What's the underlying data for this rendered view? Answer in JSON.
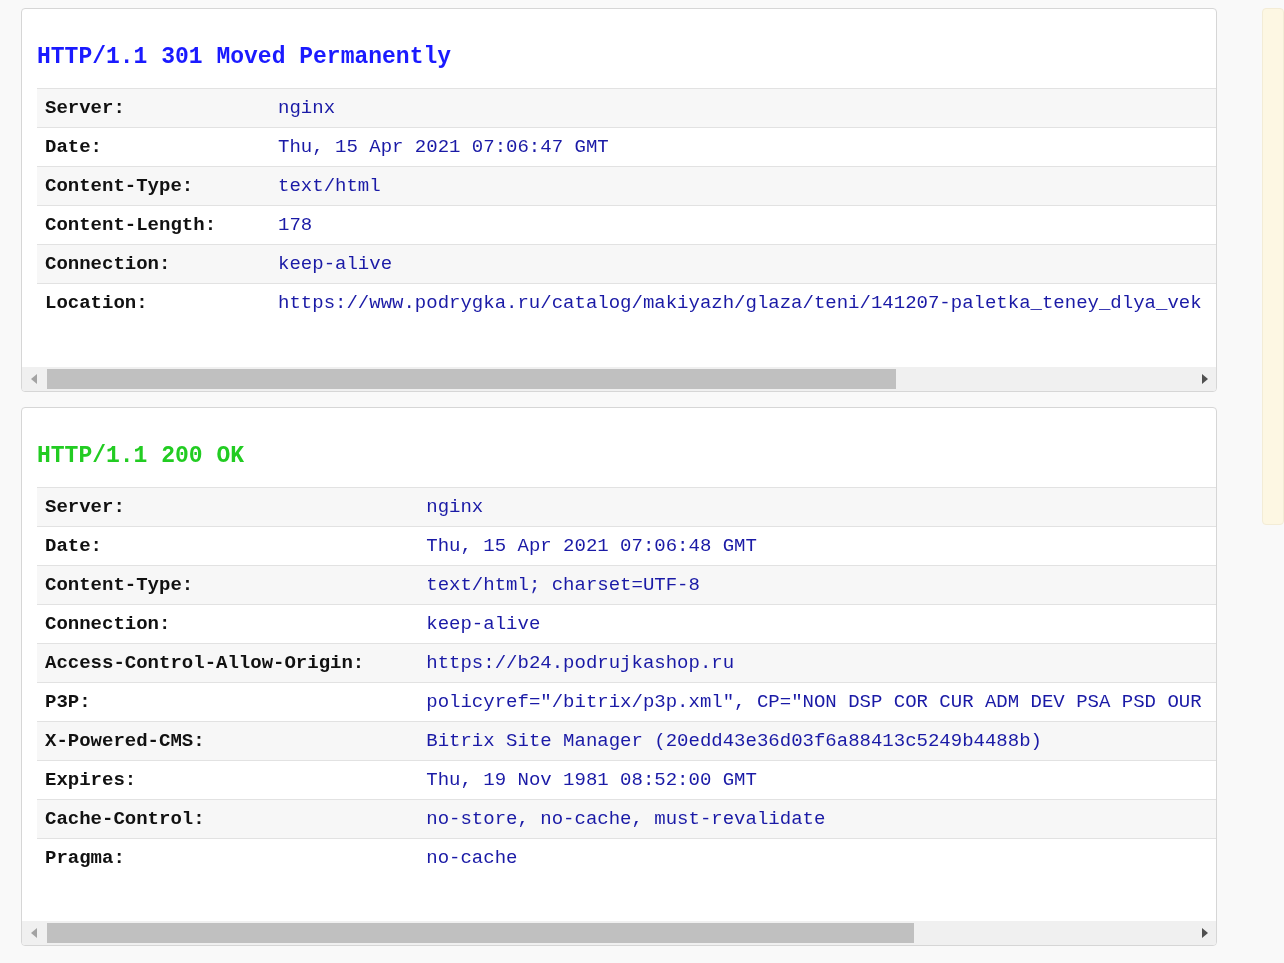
{
  "responses": [
    {
      "status_line": "HTTP/1.1 301 Moved Permanently",
      "color": "#1a1aff",
      "headers": [
        {
          "name": "Server:",
          "value": "nginx"
        },
        {
          "name": "Date:",
          "value": "Thu, 15 Apr 2021 07:06:47 GMT"
        },
        {
          "name": "Content-Type:",
          "value": "text/html"
        },
        {
          "name": "Content-Length:",
          "value": "178"
        },
        {
          "name": "Connection:",
          "value": "keep-alive"
        },
        {
          "name": "Location:",
          "value": "https://www.podrygka.ru/catalog/makiyazh/glaza/teni/141207-paletka_teney_dlya_vek"
        }
      ]
    },
    {
      "status_line": "HTTP/1.1 200 OK",
      "color": "#22cc22",
      "headers": [
        {
          "name": "Server:",
          "value": "nginx"
        },
        {
          "name": "Date:",
          "value": "Thu, 15 Apr 2021 07:06:48 GMT"
        },
        {
          "name": "Content-Type:",
          "value": "text/html; charset=UTF-8"
        },
        {
          "name": "Connection:",
          "value": "keep-alive"
        },
        {
          "name": "Access-Control-Allow-Origin:",
          "value": "https://b24.podrujkashop.ru"
        },
        {
          "name": "P3P:",
          "value": "policyref=\"/bitrix/p3p.xml\", CP=\"NON DSP COR CUR ADM DEV PSA PSD OUR"
        },
        {
          "name": "X-Powered-CMS:",
          "value": "Bitrix Site Manager (20edd43e36d03f6a88413c5249b4488b)"
        },
        {
          "name": "Expires:",
          "value": "Thu, 19 Nov 1981 08:52:00 GMT"
        },
        {
          "name": "Cache-Control:",
          "value": "no-store, no-cache, must-revalidate"
        },
        {
          "name": "Pragma:",
          "value": "no-cache"
        }
      ]
    }
  ]
}
